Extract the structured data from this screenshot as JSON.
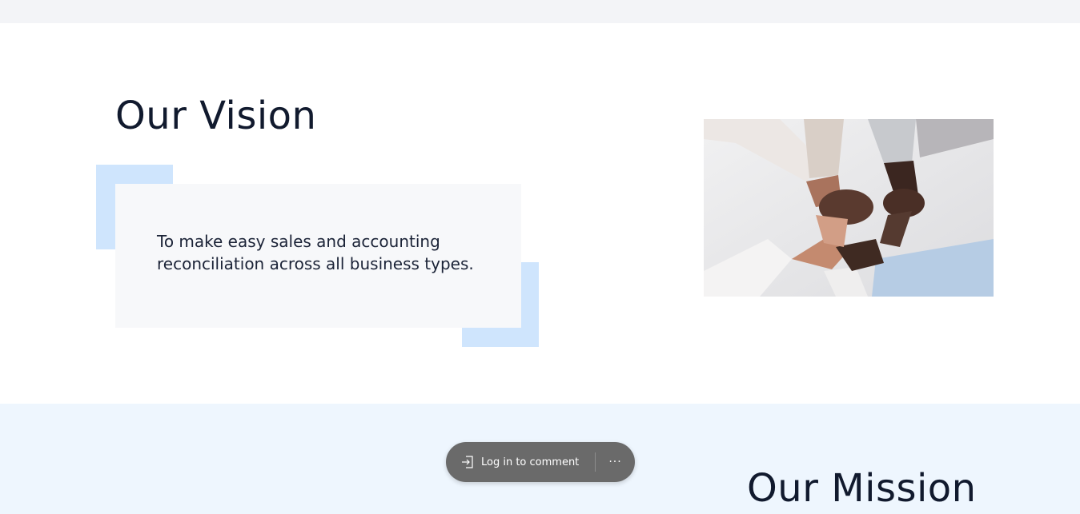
{
  "vision": {
    "title": "Our Vision",
    "text": "To make easy sales and accounting reconciliation across all business types."
  },
  "mission": {
    "title": "Our Mission"
  },
  "comment_bar": {
    "login_label": "Log in to comment",
    "more_label": "···"
  },
  "colors": {
    "heading": "#111a2e",
    "accent": "#cfe5fd",
    "card_bg": "#f7f8fa",
    "mission_bg": "#eef6fe",
    "pill_bg": "#6a6a6a"
  },
  "icons": {
    "login": "sign-in-icon",
    "more": "ellipsis-icon"
  }
}
